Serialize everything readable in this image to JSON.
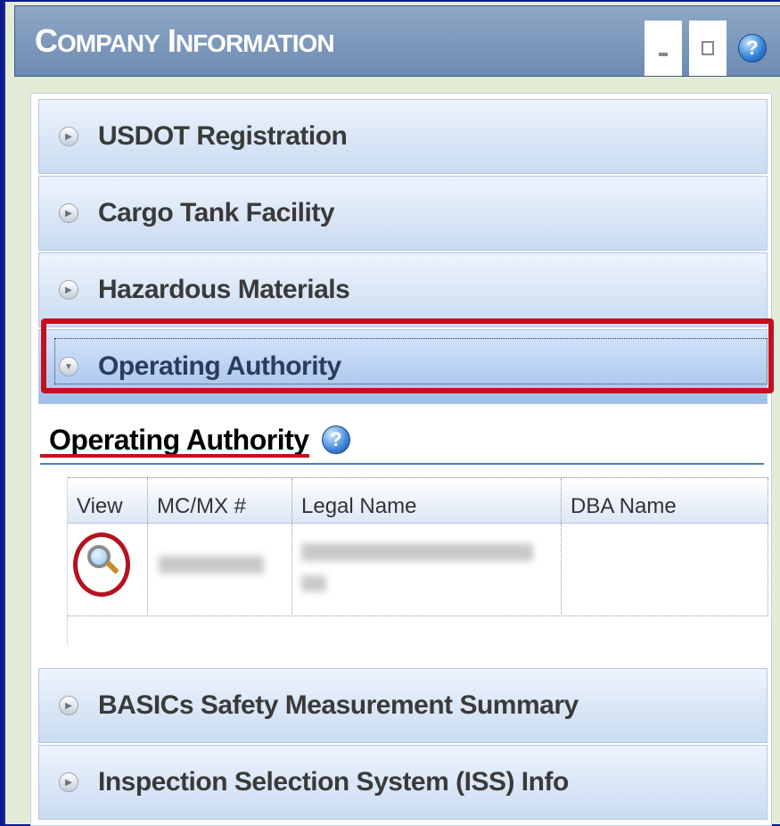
{
  "window": {
    "title_first_cap": "C",
    "title_first_rest": "OMPANY",
    "title_second_cap": "I",
    "title_second_rest": "NFORMATION",
    "help_label": "?"
  },
  "accordion": {
    "items": [
      {
        "label": "USDOT Registration",
        "expanded": false
      },
      {
        "label": "Cargo Tank Facility",
        "expanded": false
      },
      {
        "label": "Hazardous Materials",
        "expanded": false
      },
      {
        "label": "Operating Authority",
        "expanded": true
      },
      {
        "label": "BASICs Safety Measurement Summary",
        "expanded": false
      },
      {
        "label": "Inspection Selection System (ISS) Info",
        "expanded": false
      }
    ]
  },
  "operating_authority": {
    "section_title": "Operating Authority",
    "help_label": "?",
    "columns": [
      "View",
      "MC/MX #",
      "Legal Name",
      "DBA Name"
    ]
  },
  "colors": {
    "highlight_red": "#c3101e",
    "titlebar_blue": "#7a96bb",
    "accordion_blue": "#c9dbf2"
  }
}
